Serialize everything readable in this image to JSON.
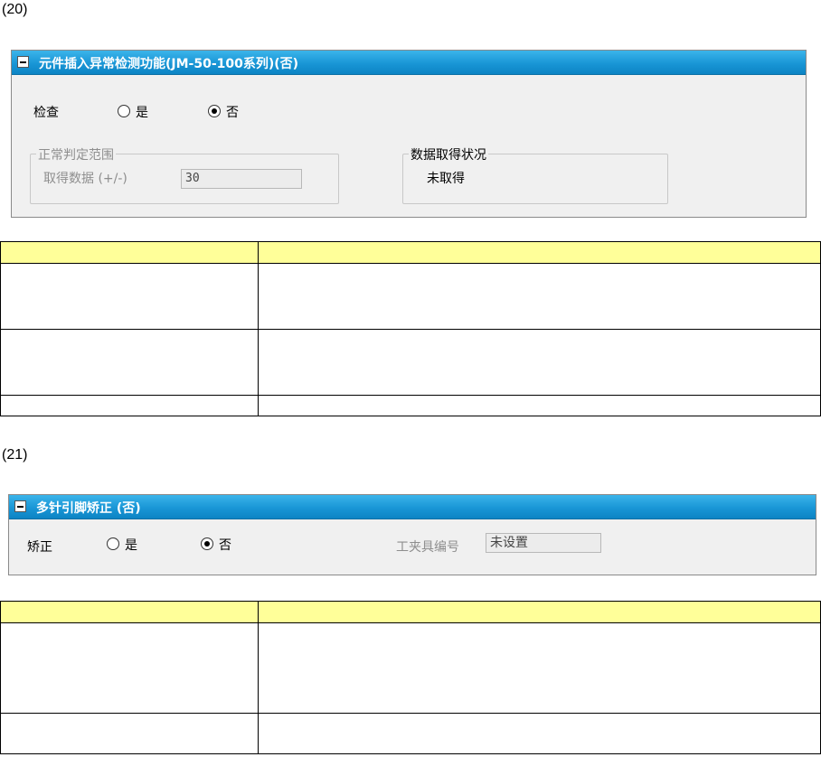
{
  "section20": {
    "label": "(20)",
    "panel": {
      "title": "元件插入异常检测功能(JM-50-100系列)(否)",
      "check_label": "检查",
      "radio_yes": "是",
      "radio_no": "否",
      "selected": "否",
      "range_group": {
        "legend": "正常判定范围",
        "field_label": "取得数据 (+/-)",
        "field_value": "30"
      },
      "status_group": {
        "legend": "数据取得状况",
        "value": "未取得"
      }
    },
    "table": {
      "rows": [
        [
          "",
          ""
        ],
        [
          "",
          ""
        ],
        [
          "",
          ""
        ],
        [
          "",
          ""
        ]
      ]
    }
  },
  "section21": {
    "label": "(21)",
    "panel": {
      "title": "多针引脚矫正 (否)",
      "correct_label": "矫正",
      "radio_yes": "是",
      "radio_no": "否",
      "selected": "否",
      "tool_label": "工夹具编号",
      "tool_value": "未设置"
    },
    "table": {
      "rows": [
        [
          "",
          ""
        ],
        [
          "",
          ""
        ],
        [
          "",
          ""
        ]
      ]
    }
  }
}
